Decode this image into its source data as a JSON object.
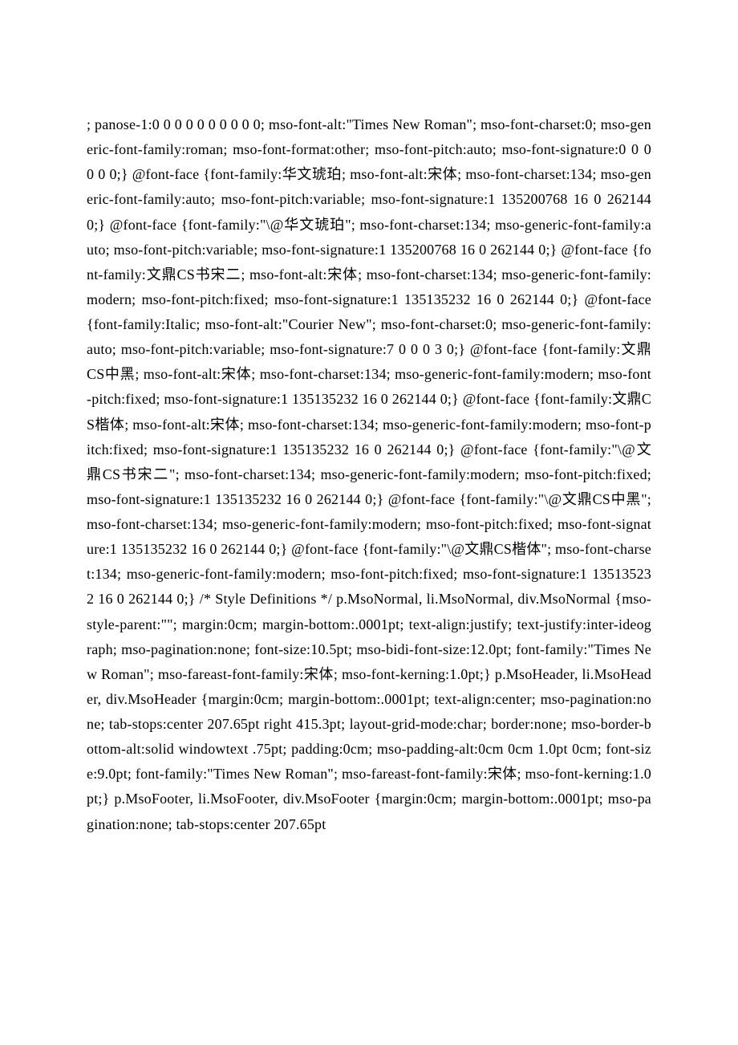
{
  "document": {
    "body_text": "; panose-1:0 0 0 0 0 0 0 0 0 0; mso-font-alt:\"Times New Roman\"; mso-font-charset:0; mso-generic-font-family:roman; mso-font-format:other; mso-font-pitch:auto; mso-font-signature:0 0 0 0 0 0;} @font-face {font-family:华文琥珀; mso-font-alt:宋体; mso-font-charset:134; mso-generic-font-family:auto; mso-font-pitch:variable; mso-font-signature:1 135200768 16 0 262144 0;} @font-face {font-family:\"\\@华文琥珀\"; mso-font-charset:134; mso-generic-font-family:auto; mso-font-pitch:variable; mso-font-signature:1 135200768 16 0 262144 0;} @font-face {font-family:文鼎CS书宋二; mso-font-alt:宋体; mso-font-charset:134; mso-generic-font-family:modern; mso-font-pitch:fixed; mso-font-signature:1 135135232 16 0 262144 0;} @font-face {font-family:Italic; mso-font-alt:\"Courier New\"; mso-font-charset:0; mso-generic-font-family:auto; mso-font-pitch:variable; mso-font-signature:7 0 0 0 3 0;} @font-face {font-family:文鼎CS中黑; mso-font-alt:宋体; mso-font-charset:134; mso-generic-font-family:modern; mso-font-pitch:fixed; mso-font-signature:1 135135232 16 0 262144 0;} @font-face {font-family:文鼎CS楷体; mso-font-alt:宋体; mso-font-charset:134; mso-generic-font-family:modern; mso-font-pitch:fixed; mso-font-signature:1 135135232 16 0 262144 0;} @font-face {font-family:\"\\@文鼎CS书宋二\"; mso-font-charset:134; mso-generic-font-family:modern; mso-font-pitch:fixed; mso-font-signature:1 135135232 16 0 262144 0;} @font-face {font-family:\"\\@文鼎CS中黑\"; mso-font-charset:134; mso-generic-font-family:modern; mso-font-pitch:fixed; mso-font-signature:1 135135232 16 0 262144 0;} @font-face {font-family:\"\\@文鼎CS楷体\"; mso-font-charset:134; mso-generic-font-family:modern; mso-font-pitch:fixed; mso-font-signature:1 135135232 16 0 262144 0;} /* Style Definitions */ p.MsoNormal, li.MsoNormal, div.MsoNormal {mso-style-parent:\"\"; margin:0cm; margin-bottom:.0001pt; text-align:justify; text-justify:inter-ideograph; mso-pagination:none; font-size:10.5pt; mso-bidi-font-size:12.0pt; font-family:\"Times New Roman\"; mso-fareast-font-family:宋体; mso-font-kerning:1.0pt;} p.MsoHeader, li.MsoHeader, div.MsoHeader {margin:0cm; margin-bottom:.0001pt; text-align:center; mso-pagination:none; tab-stops:center 207.65pt right 415.3pt; layout-grid-mode:char; border:none; mso-border-bottom-alt:solid windowtext .75pt; padding:0cm; mso-padding-alt:0cm 0cm 1.0pt 0cm; font-size:9.0pt; font-family:\"Times New Roman\"; mso-fareast-font-family:宋体; mso-font-kerning:1.0pt;} p.MsoFooter, li.MsoFooter, div.MsoFooter {margin:0cm; margin-bottom:.0001pt; mso-pagination:none; tab-stops:center 207.65pt"
  }
}
